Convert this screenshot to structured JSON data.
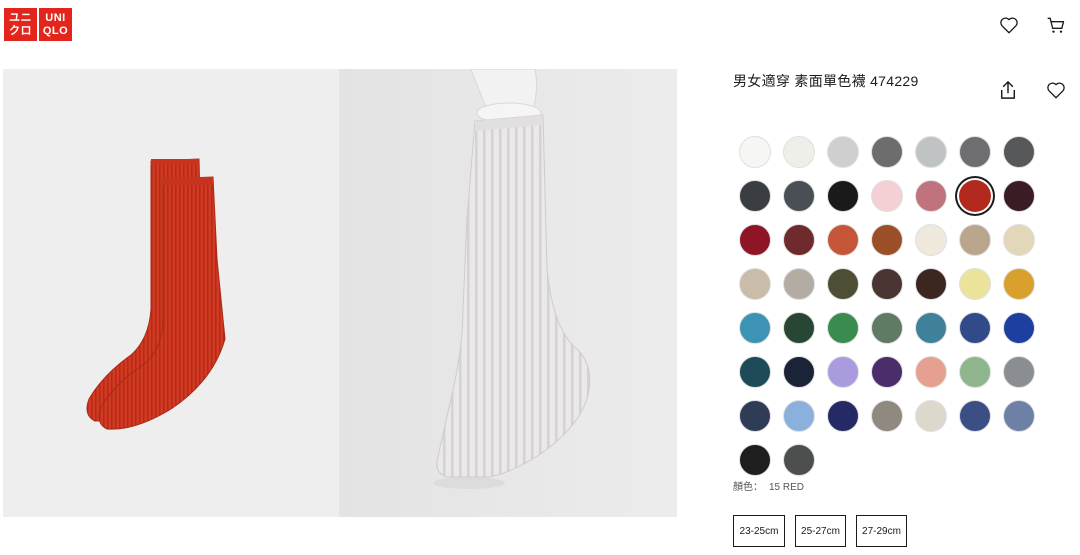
{
  "brand": {
    "logo_line1a": "ユニ",
    "logo_line1b": "クロ",
    "logo_line2a": "UNI",
    "logo_line2b": "QLO",
    "color": "#e3261c"
  },
  "header": {
    "icons": [
      "heart-icon",
      "cart-icon"
    ]
  },
  "product": {
    "title": "男女適穿 素面單色襪 474229",
    "actions": [
      "share-icon",
      "heart-icon"
    ],
    "color_label": "顏色：",
    "color_value": "15 RED",
    "selected_swatch_index": 12,
    "swatches": [
      "#f6f6f4",
      "#efefea",
      "#cfcfcf",
      "#6d6d6d",
      "#bfc3c3",
      "#6e6e72",
      "#57585a",
      "#3a3d42",
      "#4a4e55",
      "#1a1a1a",
      "#f4cfd3",
      "#c0727d",
      "#b4291d",
      "#3a1c24",
      "#8f1425",
      "#6e2a2c",
      "#c65638",
      "#9a4f26",
      "#efe8dc",
      "#b9a68c",
      "#e3d7ba",
      "#c9bca9",
      "#b3aca2",
      "#4e4e35",
      "#4b3533",
      "#3b2620",
      "#ece39a",
      "#d9a02d",
      "#3c93b4",
      "#274634",
      "#3a8b50",
      "#5f7b63",
      "#3f819b",
      "#304a8a",
      "#1d3f9f",
      "#1d4b58",
      "#1b2436",
      "#a99bdd",
      "#4a2d6a",
      "#e6a08f",
      "#8fb58d",
      "#8a8d92",
      "#2f3c55",
      "#8ab0dd",
      "#252a64",
      "#8f8980",
      "#ddd8cc",
      "#3b4f86",
      "#6f80a6",
      "#1e1e1e",
      "#4d4f4e"
    ],
    "sizes": [
      "23-25cm",
      "25-27cm",
      "27-29cm"
    ]
  },
  "gallery": {
    "image1": "red-ribbed-socks-image",
    "image2": "white-ribbed-sock-on-mannequin-image",
    "image1_color": "#cf3722",
    "image2_color": "#ececec"
  }
}
